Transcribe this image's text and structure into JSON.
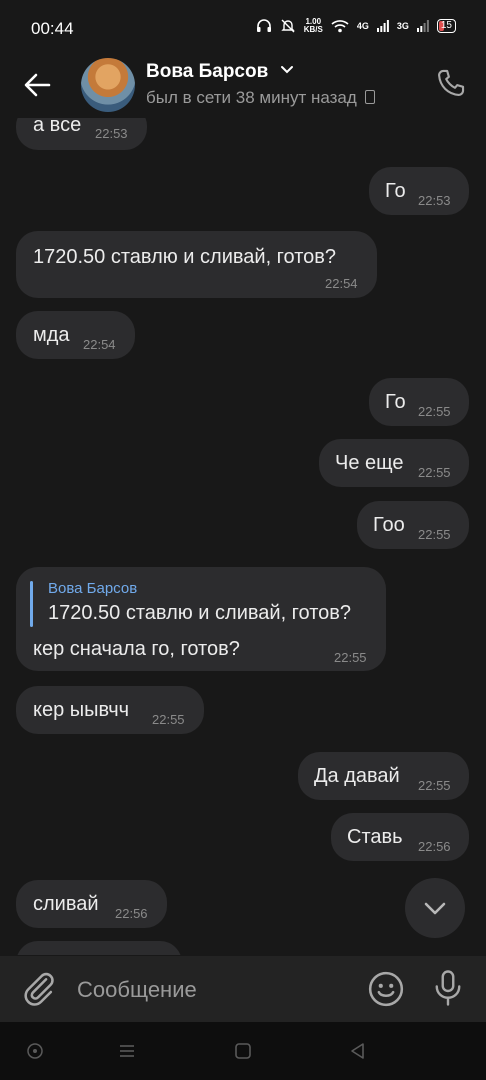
{
  "status_bar": {
    "time": "00:44",
    "speed_value": "1.00",
    "speed_unit": "KB/S",
    "network_1": "4G",
    "network_2": "3G",
    "battery": "15"
  },
  "header": {
    "contact_name": "Вова Барсов",
    "status": "был в сети 38 минут назад"
  },
  "messages": [
    {
      "side": "in",
      "text": "а все",
      "time": "22:53"
    },
    {
      "side": "out",
      "text": "Го",
      "time": "22:53"
    },
    {
      "side": "in",
      "text": "1720.50 ставлю и сливай, готов?",
      "time": "22:54"
    },
    {
      "side": "in",
      "text": "мда",
      "time": "22:54"
    },
    {
      "side": "out",
      "text": "Го",
      "time": "22:55"
    },
    {
      "side": "out",
      "text": "Че еще",
      "time": "22:55"
    },
    {
      "side": "out",
      "text": "Гоо",
      "time": "22:55"
    },
    {
      "side": "in",
      "reply_name": "Вова Барсов",
      "reply_text": "1720.50 ставлю и сливай, готов?",
      "text": "кер сначала го, готов?",
      "time": "22:55"
    },
    {
      "side": "in",
      "text": "кер ыывчч",
      "time": "22:55"
    },
    {
      "side": "out",
      "text": "Да давай",
      "time": "22:55"
    },
    {
      "side": "out",
      "text": "Ставь",
      "time": "22:56"
    },
    {
      "side": "in",
      "text": "сливай",
      "time": "22:56"
    }
  ],
  "composer": {
    "placeholder": "Сообщение"
  },
  "colors": {
    "background": "#181818",
    "bubble": "#2c2c2e",
    "accent": "#71aaeb"
  },
  "icons": [
    "back-arrow-icon",
    "chevron-down-icon",
    "device-icon",
    "phone-icon",
    "chevron-down-icon",
    "paperclip-icon",
    "emoji-icon",
    "microphone-icon",
    "nav-circle-icon",
    "nav-menu-icon",
    "nav-home-icon",
    "nav-back-icon"
  ]
}
